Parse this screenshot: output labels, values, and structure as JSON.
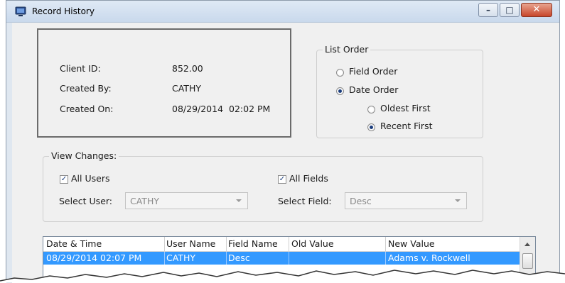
{
  "window": {
    "title": "Record History",
    "minimize_glyph": "–",
    "maximize_glyph": "□",
    "close_glyph": "✕"
  },
  "record": {
    "client_id_label": "Client ID:",
    "client_id_value": "852.00",
    "created_by_label": "Created By:",
    "created_by_value": "CATHY",
    "created_on_label": "Created On:",
    "created_on_value": "08/29/2014  02:02 PM"
  },
  "list_order": {
    "legend": "List Order",
    "field_order": "Field Order",
    "date_order": "Date Order",
    "oldest_first": "Oldest First",
    "recent_first": "Recent First"
  },
  "view_changes": {
    "legend": "View Changes:",
    "all_users": "All Users",
    "all_fields": "All Fields",
    "select_user_label": "Select User:",
    "select_user_value": "CATHY",
    "select_field_label": "Select Field:",
    "select_field_value": "Desc",
    "check_glyph": "✓"
  },
  "table": {
    "columns": [
      "Date & Time",
      "User Name",
      "Field Name",
      "Old Value",
      "New Value"
    ],
    "rows": [
      {
        "date_time": "08/29/2014 02:07 PM",
        "user": "CATHY",
        "field": "Desc",
        "old": "",
        "new": "Adams v. Rockwell"
      }
    ]
  },
  "colors": {
    "selection": "#3399ff",
    "radio_dot": "#1b3d7d",
    "title_bar": "#c9d9ec"
  }
}
